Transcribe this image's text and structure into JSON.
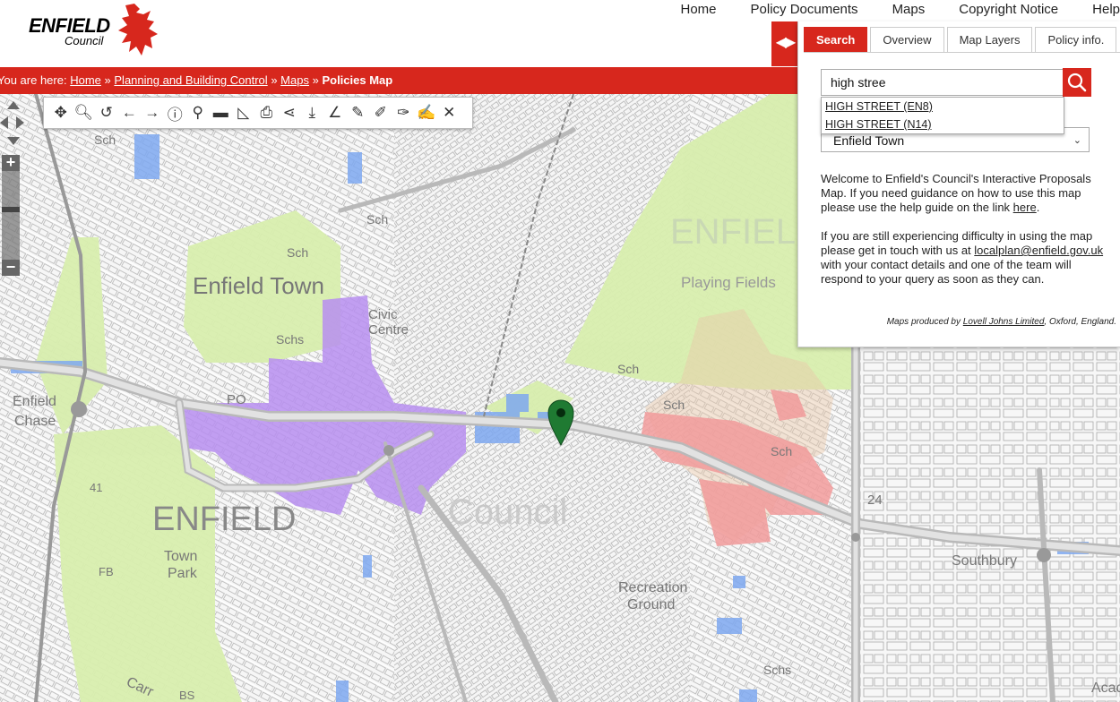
{
  "header": {
    "logo_name": "ENFIELD",
    "logo_sub": "Council",
    "nav": [
      "Home",
      "Policy Documents",
      "Maps",
      "Copyright Notice",
      "Help"
    ]
  },
  "breadcrumb": {
    "prefix": "You are here:",
    "home": "Home",
    "planning": "Planning and Building Control",
    "maps": "Maps",
    "current": "Policies Map",
    "sep": "»"
  },
  "toolbar": {
    "tools": [
      {
        "name": "pan-icon",
        "glyph": "✥"
      },
      {
        "name": "zoom-icon",
        "glyph": "🔍︎"
      },
      {
        "name": "reset-icon",
        "glyph": "↺"
      },
      {
        "name": "back-icon",
        "glyph": "←"
      },
      {
        "name": "forward-icon",
        "glyph": "→"
      },
      {
        "name": "info-icon",
        "glyph": "ⓘ"
      },
      {
        "name": "identify-icon",
        "glyph": "⚲"
      },
      {
        "name": "measure-line-icon",
        "glyph": "▬"
      },
      {
        "name": "measure-area-icon",
        "glyph": "◺"
      },
      {
        "name": "print-icon",
        "glyph": "⎙"
      },
      {
        "name": "share-icon",
        "glyph": "⋖"
      },
      {
        "name": "download-icon",
        "glyph": "⤓"
      },
      {
        "name": "draw-angle-icon",
        "glyph": "∠"
      },
      {
        "name": "draw-pen-icon",
        "glyph": "✎"
      },
      {
        "name": "draw-line-icon",
        "glyph": "✐"
      },
      {
        "name": "draw-text-icon",
        "glyph": "✑"
      },
      {
        "name": "edit-icon",
        "glyph": "✍"
      },
      {
        "name": "close-icon",
        "glyph": "✕"
      }
    ]
  },
  "panel": {
    "toggle_glyph": "◀▶",
    "tabs": [
      "Search",
      "Overview",
      "Map Layers",
      "Policy info."
    ],
    "search_value": "high stree",
    "suggestions": [
      "HIGH STREET (EN8)",
      "HIGH STREET (N14)"
    ],
    "select_value": "Enfield Town",
    "welcome_text": "Welcome to Enfield's Council's Interactive Proposals Map. If you need guidance on how to use this map please use the help guide on the link",
    "here_link": "here",
    "difficulty_text": "If you are still experiencing difficulty in using the map please get in touch with us at",
    "email": "localplan@enfield.gov.uk",
    "difficulty_text2": "with your contact details and one of the team will respond to your query as soon as they can.",
    "credit_prefix": "Maps produced by",
    "credit_link": "Lovell Johns Limited",
    "credit_suffix": ", Oxford, England."
  },
  "map": {
    "labels": {
      "enfield_town": "Enfield Town",
      "civic_centre_1": "Civic",
      "civic_centre_2": "Centre",
      "enfield_chase_1": "Enfield",
      "enfield_chase_2": "Chase",
      "enfield_big": "ENFIELD",
      "enfield_watermark": "ENFIELD",
      "playing_fields": "Playing Fields",
      "town_park_1": "Town",
      "town_park_2": "Park",
      "recreation_1": "Recreation",
      "recreation_2": "Ground",
      "southbury": "Southbury",
      "acad": "Acad",
      "sch": "Sch",
      "schs": "Schs",
      "po": "PO",
      "fb": "FB",
      "bs": "BS",
      "n24": "24",
      "n41": "41",
      "carr": "Carr",
      "council_wm": "Council"
    },
    "colors": {
      "green": "#d8eeae",
      "purple": "#b78ef0",
      "blue": "#7ea8f0",
      "red": "#f29b9b",
      "accent": "#d7271d"
    }
  }
}
